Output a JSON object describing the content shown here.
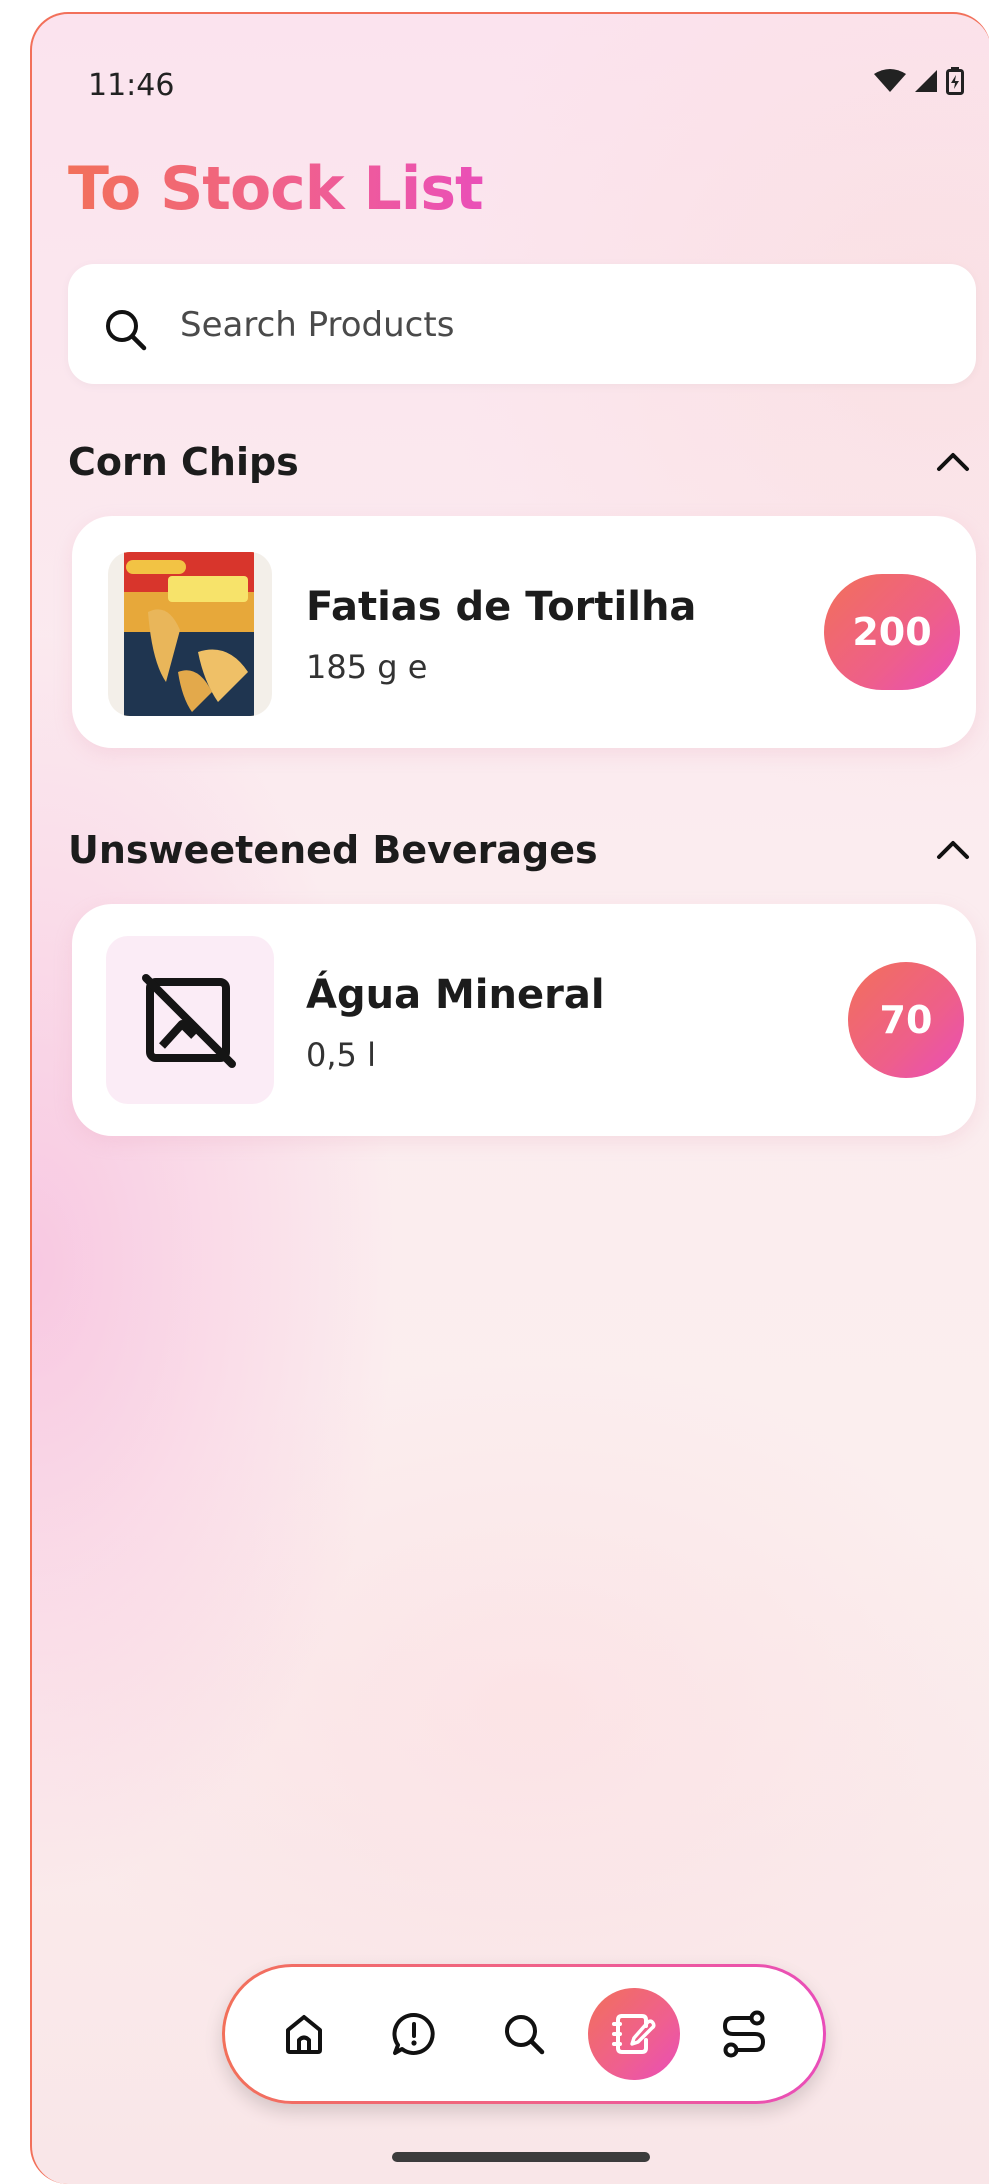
{
  "status_bar": {
    "time": "11:46"
  },
  "header": {
    "title": "To Stock List"
  },
  "search": {
    "placeholder": "Search Products"
  },
  "sections": [
    {
      "title": "Corn Chips",
      "items": [
        {
          "name": "Fatias de Tortilha",
          "size": "185 g e",
          "quantity": "200",
          "image": "tortilla-strips-package"
        }
      ]
    },
    {
      "title": "Unsweetened Beverages",
      "items": [
        {
          "name": "Água Mineral",
          "size": "0,5 l",
          "quantity": "70",
          "image": "no-image-icon"
        }
      ]
    }
  ],
  "nav": {
    "items": [
      "home-icon",
      "feedback-icon",
      "search-icon",
      "notebook-edit-icon",
      "route-icon"
    ],
    "active": "notebook-edit-icon"
  },
  "colors": {
    "accent_start": "#f2705a",
    "accent_mid": "#ef5f90",
    "accent_end": "#e94db9"
  }
}
